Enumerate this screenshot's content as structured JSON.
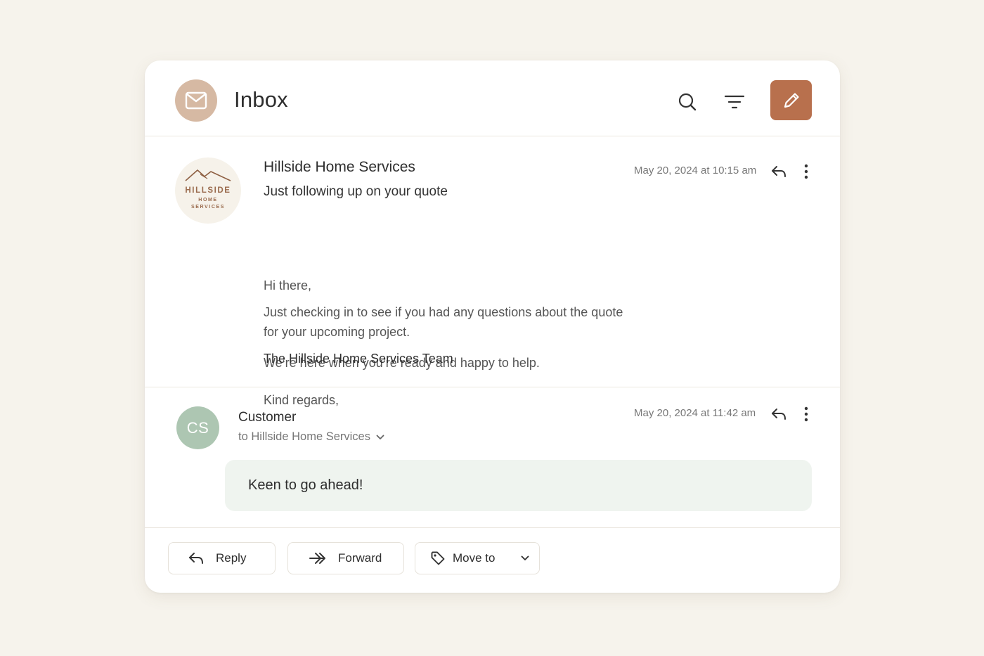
{
  "header": {
    "title": "Inbox",
    "accent_color": "#b8704d",
    "icons": [
      "mail-icon",
      "search-icon",
      "filter-icon",
      "pencil-icon"
    ]
  },
  "messages": [
    {
      "logo": {
        "name": "HILLSIDE",
        "line2": "HOME",
        "line3": "SERVICES"
      },
      "sender": "Hillside Home Services",
      "subject": "Just following up on your quote",
      "timestamp": "May 20, 2024 at 10:15 am",
      "body": {
        "greeting": "Hi there,",
        "p1_line1": "Just checking in to see if you had any questions about the quote",
        "p1_line2": "for your upcoming project.",
        "p2": "We’re here when you’re ready and happy to help.",
        "closing": "Kind regards,",
        "signature": "The Hillside Home Services Team"
      }
    },
    {
      "avatar_initials": "CS",
      "avatar_color": "#adc6b2",
      "sender": "Customer",
      "to": "to Hillside Home Services",
      "timestamp": "May 20, 2024 at 11:42 am",
      "body": "Keen to go ahead!"
    }
  ],
  "footer": {
    "reply_label": "Reply",
    "forward_label": "Forward",
    "move_label": "Move to"
  }
}
